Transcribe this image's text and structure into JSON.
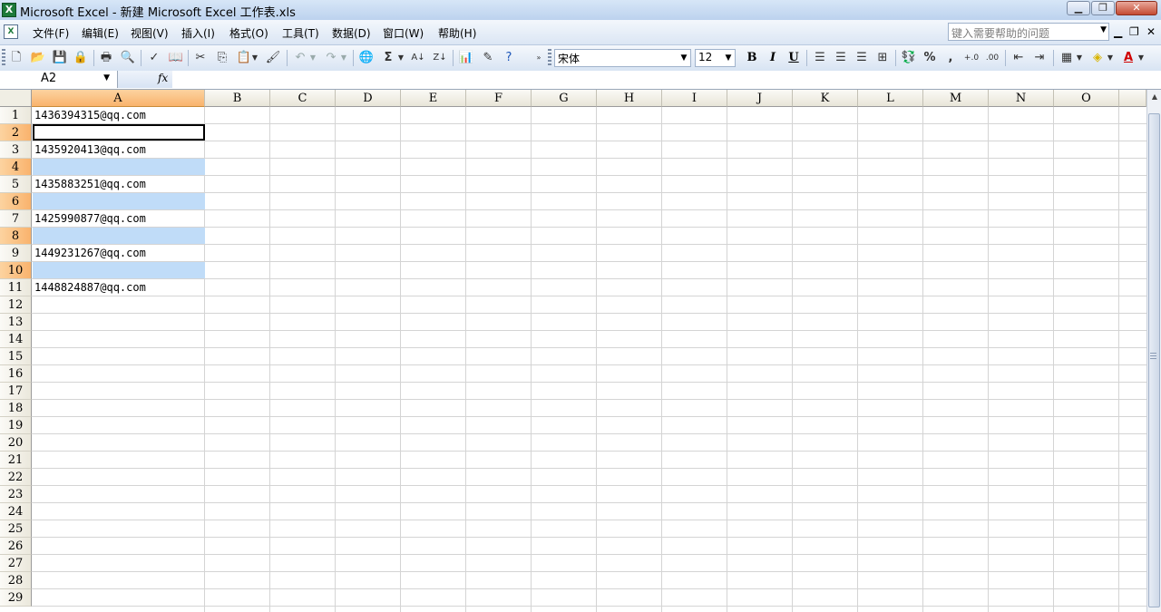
{
  "window": {
    "title": "Microsoft Excel - 新建 Microsoft Excel 工作表.xls"
  },
  "menu": [
    "文件(F)",
    "编辑(E)",
    "视图(V)",
    "插入(I)",
    "格式(O)",
    "工具(T)",
    "数据(D)",
    "窗口(W)",
    "帮助(H)"
  ],
  "help_box": {
    "placeholder": "键入需要帮助的问题"
  },
  "toolbar": {
    "font_name": "宋体",
    "font_size": "12",
    "bold": "B",
    "italic": "I",
    "underline": "U",
    "percent": "%",
    "comma": ",",
    "autosum": "Σ"
  },
  "formula_bar": {
    "name_box": "A2",
    "fx": "fx",
    "value": ""
  },
  "columns": [
    "A",
    "B",
    "C",
    "D",
    "E",
    "F",
    "G",
    "H",
    "I",
    "J",
    "K",
    "L",
    "M",
    "N",
    "O"
  ],
  "rows": [
    "1",
    "2",
    "3",
    "4",
    "5",
    "6",
    "7",
    "8",
    "9",
    "10",
    "11",
    "12",
    "13",
    "14",
    "15",
    "16",
    "17",
    "18",
    "19",
    "20",
    "21",
    "22",
    "23",
    "24",
    "25",
    "26",
    "27",
    "28",
    "29"
  ],
  "cells_A": [
    "1436394315@qq.com",
    "",
    "1435920413@qq.com",
    "",
    "1435883251@qq.com",
    "",
    "1425990877@qq.com",
    "",
    "1449231267@qq.com",
    "",
    "1448824887@qq.com"
  ],
  "selection": {
    "active_cell": "A2",
    "selected_column": "A",
    "selected_rows": [
      "2",
      "4",
      "6",
      "8",
      "10"
    ]
  }
}
